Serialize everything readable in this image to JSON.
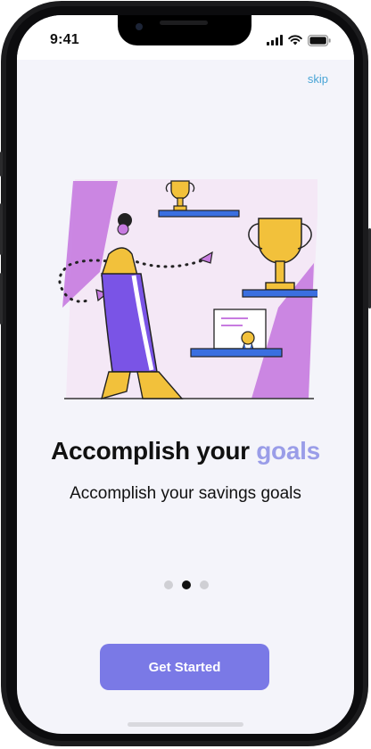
{
  "status_bar": {
    "time": "9:41"
  },
  "onboarding": {
    "skip_label": "skip",
    "title_main": "Accomplish your ",
    "title_accent": "goals",
    "subtitle": "Accomplish your savings goals",
    "pagination": {
      "total": 3,
      "active_index": 1
    },
    "cta_label": "Get Started"
  },
  "colors": {
    "accent": "#7a79e6",
    "title_accent": "#9a9de8",
    "skip_link": "#4aa5d6",
    "screen_background": "#f4f4fa"
  },
  "icons": [
    "cellular-signal-icon",
    "wifi-icon",
    "battery-icon"
  ]
}
